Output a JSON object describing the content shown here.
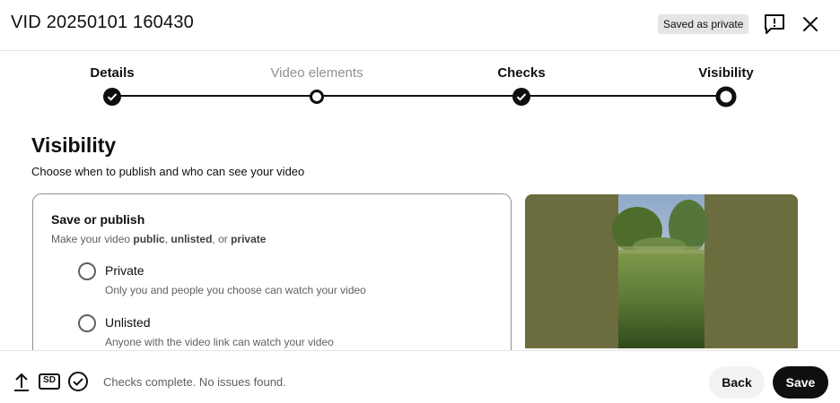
{
  "header": {
    "title": "VID 20250101 160430",
    "saved_badge": "Saved as private",
    "feedback_icon": "feedback-icon",
    "close_icon": "close-icon"
  },
  "stepper": {
    "steps": [
      {
        "label": "Details",
        "state": "done"
      },
      {
        "label": "Video elements",
        "state": "incomplete"
      },
      {
        "label": "Checks",
        "state": "done"
      },
      {
        "label": "Visibility",
        "state": "current"
      }
    ]
  },
  "main": {
    "title": "Visibility",
    "subtitle": "Choose when to publish and who can see your video",
    "save_publish": {
      "title": "Save or publish",
      "subtitle_prefix": "Make your video ",
      "opt_public": "public",
      "sep1": ", ",
      "opt_unlisted": "unlisted",
      "sep2": ", or ",
      "opt_private": "private",
      "options": [
        {
          "label": "Private",
          "description": "Only you and people you choose can watch your video"
        },
        {
          "label": "Unlisted",
          "description": "Anyone with the video link can watch your video"
        }
      ]
    }
  },
  "footer": {
    "icons": [
      "upload-icon",
      "sd-icon",
      "check-circle-icon"
    ],
    "sd_label": "SD",
    "status": "Checks complete. No issues found.",
    "back_label": "Back",
    "save_label": "Save"
  },
  "colors": {
    "text": "#0f0f0f",
    "muted": "#606060",
    "badge_bg": "#e5e5e5",
    "video_bg": "#6c6d3e"
  }
}
